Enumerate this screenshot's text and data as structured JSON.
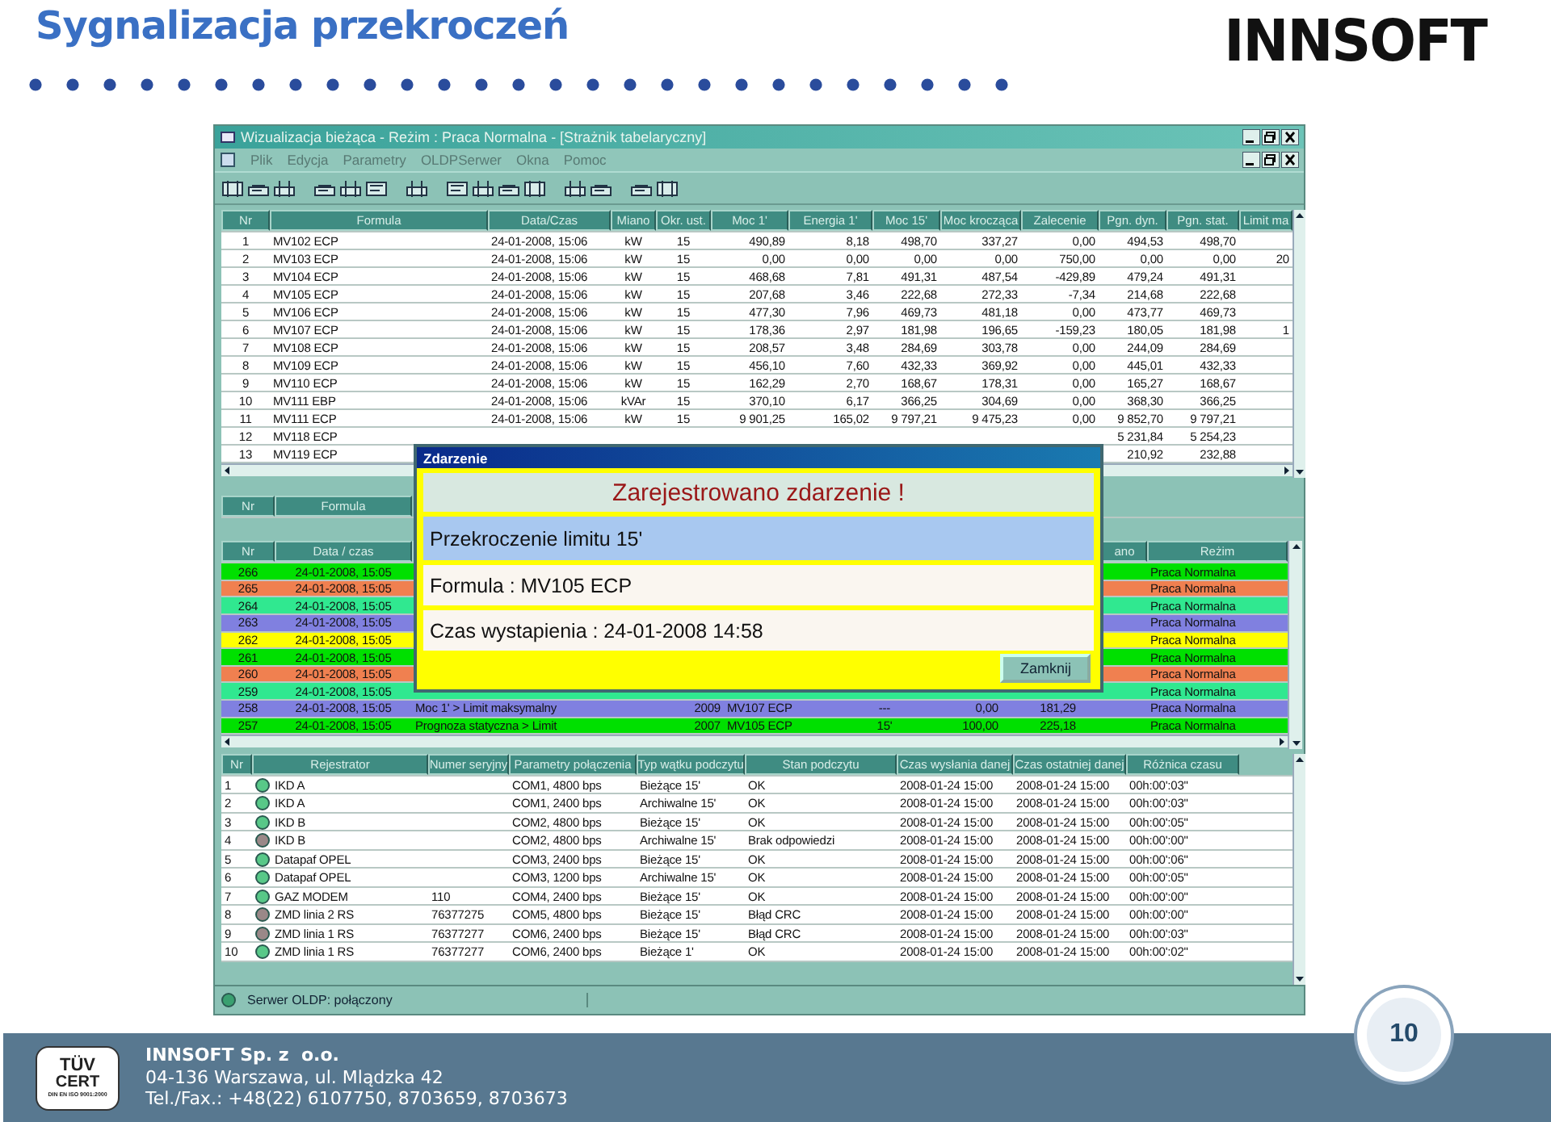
{
  "slide": {
    "title": "Sygnalizacja przekroczeń",
    "logo": "INNSOFT",
    "page_number": "10"
  },
  "window": {
    "title": "Wizualizacja bieżąca - Reżim : Praca Normalna - [Strażnik tabelaryczny]",
    "menu": [
      "Plik",
      "Edycja",
      "Parametry",
      "OLDPSerwer",
      "Okna",
      "Pomoc"
    ]
  },
  "limits_table": {
    "columns": [
      "Nr",
      "Formula",
      "Data/Czas",
      "Miano",
      "Okr. ust.",
      "Moc 1'",
      "Energia 1'",
      "Moc 15'",
      "Moc krocząca",
      "Zalecenie",
      "Pgn. dyn.",
      "Pgn. stat.",
      "Limit ma"
    ],
    "rows": [
      {
        "cells": [
          "1",
          "MV102 ECP",
          "24-01-2008, 15:06",
          "kW",
          "15",
          "490,89",
          "8,18",
          "498,70",
          "337,27",
          "0,00",
          "494,53",
          "498,70"
        ]
      },
      {
        "cells": [
          "2",
          "MV103 ECP",
          "24-01-2008, 15:06",
          "kW",
          "15",
          "0,00",
          "0,00",
          "0,00",
          "0,00",
          "750,00",
          "0,00",
          "0,00",
          "20"
        ]
      },
      {
        "cells": [
          "3",
          "MV104 ECP",
          "24-01-2008, 15:06",
          "kW",
          "15",
          "468,68",
          "7,81",
          "491,31",
          "487,54",
          "-429,89",
          "479,24",
          "491,31"
        ]
      },
      {
        "cells": [
          "4",
          "MV105 ECP",
          "24-01-2008, 15:06",
          "kW",
          "15",
          "207,68",
          "3,46",
          "222,68",
          "272,33",
          "-7,34",
          "214,68",
          "222,68"
        ]
      },
      {
        "cells": [
          "5",
          "MV106 ECP",
          "24-01-2008, 15:06",
          "kW",
          "15",
          "477,30",
          "7,96",
          "469,73",
          "481,18",
          "0,00",
          "473,77",
          "469,73"
        ]
      },
      {
        "cells": [
          "6",
          "MV107 ECP",
          "24-01-2008, 15:06",
          "kW",
          "15",
          "178,36",
          "2,97",
          "181,98",
          "196,65",
          "-159,23",
          "180,05",
          "181,98",
          "1"
        ]
      },
      {
        "cells": [
          "7",
          "MV108 ECP",
          "24-01-2008, 15:06",
          "kW",
          "15",
          "208,57",
          "3,48",
          "284,69",
          "303,78",
          "0,00",
          "244,09",
          "284,69"
        ]
      },
      {
        "cells": [
          "8",
          "MV109 ECP",
          "24-01-2008, 15:06",
          "kW",
          "15",
          "456,10",
          "7,60",
          "432,33",
          "369,92",
          "0,00",
          "445,01",
          "432,33"
        ]
      },
      {
        "cells": [
          "9",
          "MV110 ECP",
          "24-01-2008, 15:06",
          "kW",
          "15",
          "162,29",
          "2,70",
          "168,67",
          "178,31",
          "0,00",
          "165,27",
          "168,67"
        ]
      },
      {
        "cells": [
          "10",
          "MV111 EBP",
          "24-01-2008, 15:06",
          "kVAr",
          "15",
          "370,10",
          "6,17",
          "366,25",
          "304,69",
          "0,00",
          "368,30",
          "366,25"
        ]
      },
      {
        "cells": [
          "11",
          "MV111 ECP",
          "24-01-2008, 15:06",
          "kW",
          "15",
          "9 901,25",
          "165,02",
          "9 797,21",
          "9 475,23",
          "0,00",
          "9 852,70",
          "9 797,21"
        ]
      },
      {
        "cells": [
          "12",
          "MV118 ECP"
        ],
        "tail_cells": [
          "5 231,84",
          "5 254,23"
        ]
      },
      {
        "cells": [
          "13",
          "MV119 ECP"
        ],
        "tail_cells": [
          "210,92",
          "232,88"
        ]
      }
    ]
  },
  "back_table": {
    "columns": [
      "Nr",
      "Formula"
    ]
  },
  "events_table": {
    "columns": [
      "Nr",
      "Data / czas",
      "ano",
      "Reżim"
    ],
    "rows": [
      {
        "nr": "266",
        "date": "24-01-2008, 15:05",
        "mode": "Praca Normalna",
        "color": "#00e000"
      },
      {
        "nr": "265",
        "date": "24-01-2008, 15:05",
        "mode": "Praca Normalna",
        "color": "#f08050"
      },
      {
        "nr": "264",
        "date": "24-01-2008, 15:05",
        "mode": "Praca Normalna",
        "color": "#30e890"
      },
      {
        "nr": "263",
        "date": "24-01-2008, 15:05",
        "mode": "Praca Normalna",
        "color": "#8080e0"
      },
      {
        "nr": "262",
        "date": "24-01-2008, 15:05",
        "mode": "Praca Normalna",
        "color": "#ffff00"
      },
      {
        "nr": "261",
        "date": "24-01-2008, 15:05",
        "mode": "Praca Normalna",
        "color": "#00e000"
      },
      {
        "nr": "260",
        "date": "24-01-2008, 15:05",
        "mode": "Praca Normalna",
        "color": "#f08050"
      },
      {
        "nr": "259",
        "date": "24-01-2008, 15:05",
        "mode": "Praca Normalna",
        "color": "#30e890"
      },
      {
        "nr": "258",
        "date": "24-01-2008, 15:05",
        "description": "Moc 1' > Limit maksymalny",
        "code": "2009",
        "formula": "MV107 ECP",
        "period": "---",
        "value_1": "0,00",
        "value_2": "181,29",
        "mode": "Praca Normalna",
        "color": "#8080e0"
      },
      {
        "nr": "257",
        "date": "24-01-2008, 15:05",
        "description": "Prognoza statyczna > Limit",
        "code": "2007",
        "formula": "MV105 ECP",
        "period": "15'",
        "value_1": "100,00",
        "value_2": "225,18",
        "mode": "Praca Normalna",
        "color": "#00e000"
      }
    ]
  },
  "dialog": {
    "title": "Zdarzenie",
    "heading": "Zarejestrowano zdarzenie !",
    "message": "Przekroczenie limitu 15'",
    "formula": "Formula : MV105 ECP",
    "time": "Czas wystapienia : 24-01-2008 14:58",
    "button": "Zamknij"
  },
  "recorders_table": {
    "columns": [
      "Nr",
      "Rejestrator",
      "Numer seryjny",
      "Parametry połączenia",
      "Typ wątku podczytu",
      "Stan podczytu",
      "Czas wysłania danej",
      "Czas ostatniej danej",
      "Różnica czasu"
    ],
    "rows": [
      {
        "color": "#58c888",
        "cells": [
          "1",
          "IKD A",
          "",
          "COM1, 4800 bps",
          "Bieżące 15'",
          "OK",
          "2008-01-24 15:00",
          "2008-01-24 15:00",
          "00h:00':03\""
        ]
      },
      {
        "color": "#58c888",
        "cells": [
          "2",
          "IKD A",
          "",
          "COM1, 2400 bps",
          "Archiwalne 15'",
          "OK",
          "2008-01-24 15:00",
          "2008-01-24 15:00",
          "00h:00':03\""
        ]
      },
      {
        "color": "#58c888",
        "cells": [
          "3",
          "IKD B",
          "",
          "COM2, 4800 bps",
          "Bieżące 15'",
          "OK",
          "2008-01-24 15:00",
          "2008-01-24 15:00",
          "00h:00':05\""
        ]
      },
      {
        "color": "#9a8888",
        "cells": [
          "4",
          "IKD B",
          "",
          "COM2, 4800 bps",
          "Archiwalne 15'",
          "Brak odpowiedzi",
          "2008-01-24 15:00",
          "2008-01-24 15:00",
          "00h:00':00\""
        ]
      },
      {
        "color": "#58c888",
        "cells": [
          "5",
          "Datapaf OPEL",
          "",
          "COM3, 2400 bps",
          "Bieżące 15'",
          "OK",
          "2008-01-24 15:00",
          "2008-01-24 15:00",
          "00h:00':06\""
        ]
      },
      {
        "color": "#58c888",
        "cells": [
          "6",
          "Datapaf OPEL",
          "",
          "COM3, 1200 bps",
          "Archiwalne 15'",
          "OK",
          "2008-01-24 15:00",
          "2008-01-24 15:00",
          "00h:00':05\""
        ]
      },
      {
        "color": "#58c888",
        "cells": [
          "7",
          "GAZ MODEM",
          "110",
          "COM4, 2400 bps",
          "Bieżące 15'",
          "OK",
          "2008-01-24 15:00",
          "2008-01-24 15:00",
          "00h:00':00\""
        ]
      },
      {
        "color": "#9a8888",
        "cells": [
          "8",
          "ZMD linia 2 RS",
          "76377275",
          "COM5, 4800 bps",
          "Bieżące 15'",
          "Błąd CRC",
          "2008-01-24 15:00",
          "2008-01-24 15:00",
          "00h:00':00\""
        ]
      },
      {
        "color": "#9a8888",
        "cells": [
          "9",
          "ZMD linia 1 RS",
          "76377277",
          "COM6, 2400 bps",
          "Bieżące 15'",
          "Błąd CRC",
          "2008-01-24 15:00",
          "2008-01-24 15:00",
          "00h:00':03\""
        ]
      },
      {
        "color": "#58c888",
        "cells": [
          "10",
          "ZMD linia 1 RS",
          "76377277",
          "COM6, 2400 bps",
          "Bieżące 1'",
          "OK",
          "2008-01-24 15:00",
          "2008-01-24 15:00",
          "00h:00':02\""
        ]
      }
    ]
  },
  "status_bar": {
    "text": "Serwer OLDP: połączony",
    "color": "#3aa070"
  },
  "footer": {
    "company": "INNSOFT Sp. z  o.o.",
    "address": "04-136 Warszawa, ul. Mlądzka 42",
    "phone": "Tel./Fax.: +48(22) 6107750, 8703659, 8703673",
    "cert_logo": {
      "top": "TÜV",
      "middle": "CERT",
      "bottom": "DIN EN ISO 9001:2000"
    }
  }
}
